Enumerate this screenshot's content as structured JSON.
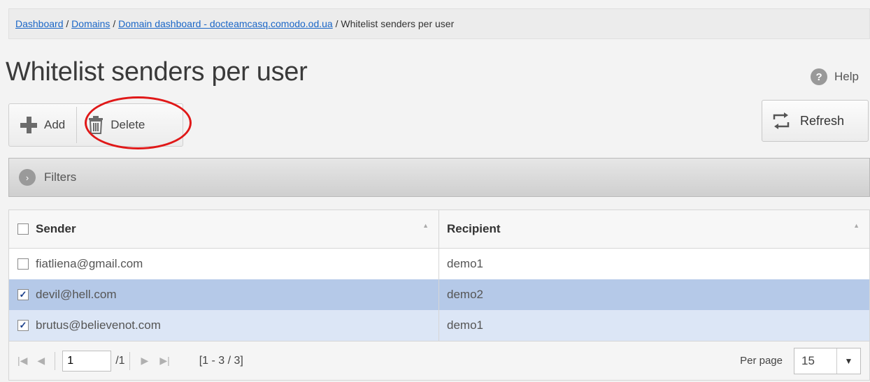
{
  "breadcrumb": {
    "items": [
      "Dashboard",
      "Domains",
      "Domain dashboard - docteamcasq.comodo.od.ua"
    ],
    "separator": "/",
    "current": "Whitelist senders per user"
  },
  "page": {
    "title": "Whitelist senders per user",
    "help_label": "Help",
    "help_glyph": "?"
  },
  "toolbar": {
    "add_label": "Add",
    "delete_label": "Delete",
    "refresh_label": "Refresh"
  },
  "filters": {
    "label": "Filters",
    "glyph": "›"
  },
  "table": {
    "columns": [
      "Sender",
      "Recipient"
    ],
    "sort_glyph": "▲",
    "rows": [
      {
        "sender": "fiatliena@gmail.com",
        "recipient": "demo1",
        "checked": false,
        "check_glyph": ""
      },
      {
        "sender": "devil@hell.com",
        "recipient": "demo2",
        "checked": true,
        "check_glyph": "✓"
      },
      {
        "sender": "brutus@believenot.com",
        "recipient": "demo1",
        "checked": true,
        "check_glyph": "✓"
      }
    ]
  },
  "pager": {
    "first_glyph": "|◀",
    "prev_glyph": "◀",
    "next_glyph": "▶",
    "last_glyph": "▶|",
    "page_value": "1",
    "total_pages": "/1",
    "range": "[1 - 3 / 3]",
    "per_page_label": "Per page",
    "per_page_value": "15",
    "dropdown_glyph": "▼"
  },
  "colors": {
    "highlight_circle": "#e01818",
    "selected_row": "#b5c9e8",
    "selected_row_alt": "#dce6f6",
    "link": "#1a66c7"
  }
}
